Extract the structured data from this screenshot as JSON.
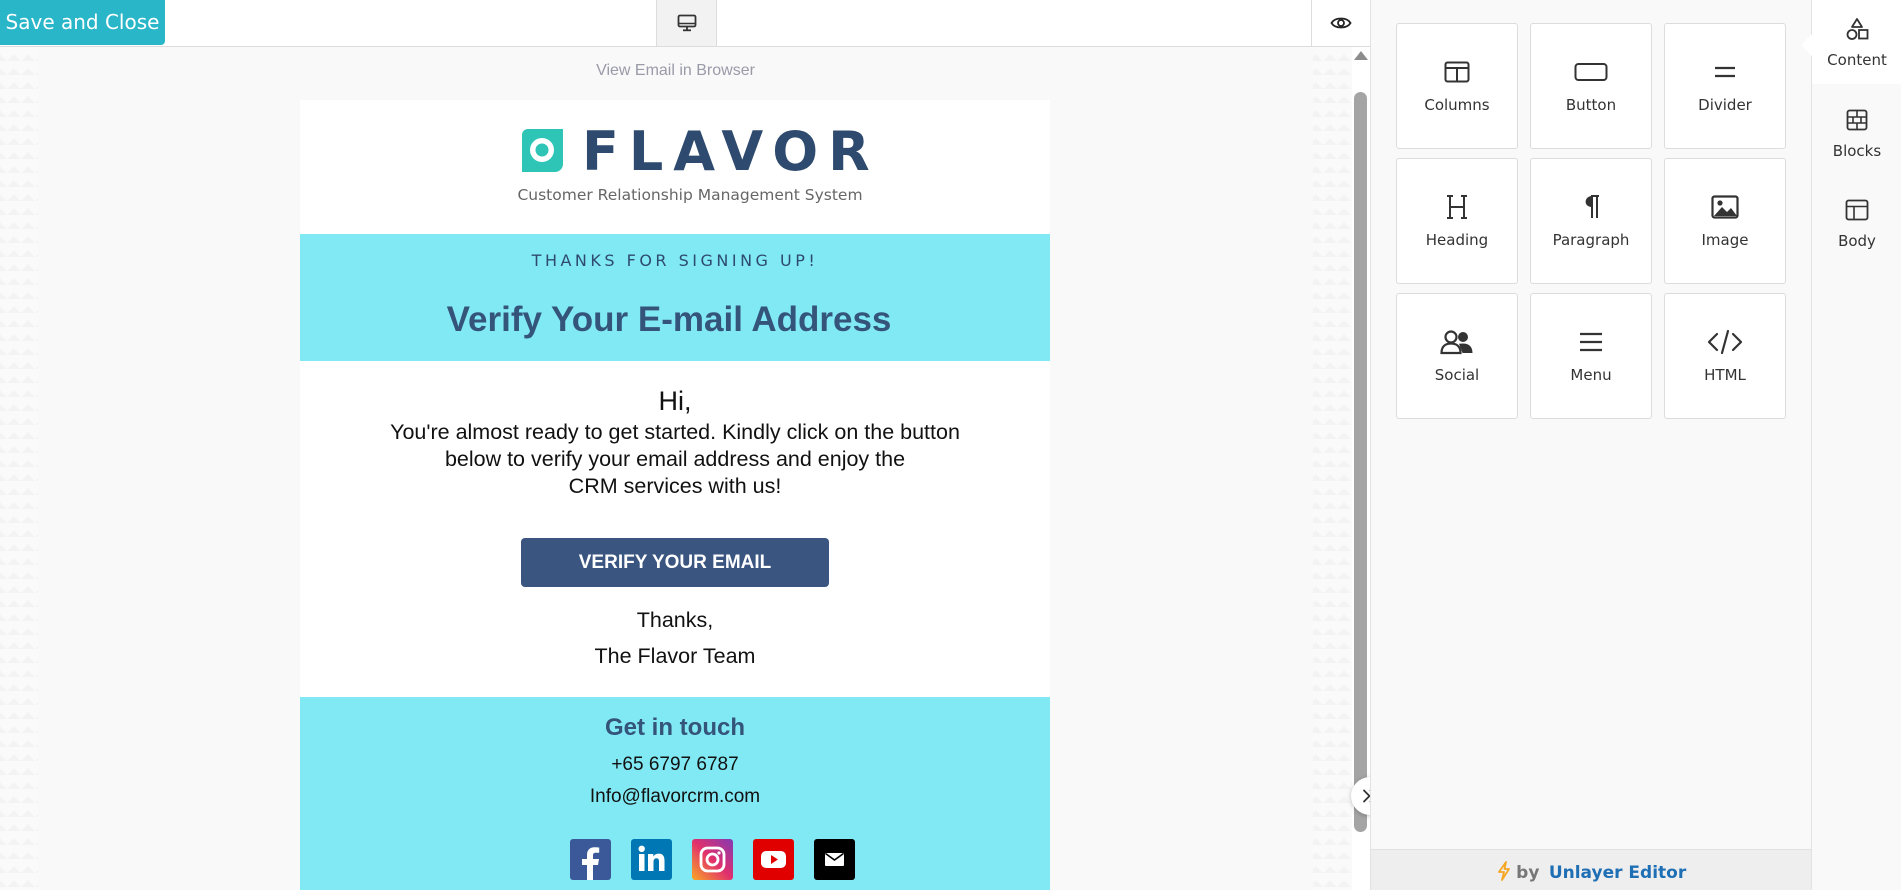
{
  "toolbar": {
    "save_close_label": "Save and Close",
    "device_icon": "desktop-icon",
    "preview_icon": "eye-icon"
  },
  "email": {
    "view_in_browser": "View Email in Browser",
    "logo_word": "FLAVOR",
    "logo_subtitle": "Customer Relationship Management System",
    "hero_kicker": "THANKS FOR SIGNING UP!",
    "hero_title": "Verify Your E-mail Address",
    "greeting": "Hi,",
    "intro_line1": "You're almost ready to get started. Kindly click on the button",
    "intro_line2": "below to verify your email address and enjoy the",
    "intro_line3": "CRM services with us!",
    "verify_button": "VERIFY YOUR EMAIL",
    "thanks": "Thanks,",
    "team": "The Flavor Team",
    "footer_title": "Get in touch",
    "phone": "+65 6797 6787",
    "mail": "Info@flavorcrm.com",
    "socials": [
      "facebook-icon",
      "linkedin-icon",
      "instagram-icon",
      "youtube-icon",
      "mail-icon"
    ]
  },
  "content_tools": [
    {
      "label": "Columns",
      "icon": "columns-icon"
    },
    {
      "label": "Button",
      "icon": "button-icon"
    },
    {
      "label": "Divider",
      "icon": "divider-icon"
    },
    {
      "label": "Heading",
      "icon": "heading-icon"
    },
    {
      "label": "Paragraph",
      "icon": "paragraph-icon"
    },
    {
      "label": "Image",
      "icon": "image-icon"
    },
    {
      "label": "Social",
      "icon": "social-icon"
    },
    {
      "label": "Menu",
      "icon": "menu-icon"
    },
    {
      "label": "HTML",
      "icon": "code-icon"
    }
  ],
  "tabs": [
    {
      "label": "Content",
      "icon": "shapes-icon",
      "active": true
    },
    {
      "label": "Blocks",
      "icon": "blocks-icon",
      "active": false
    },
    {
      "label": "Body",
      "icon": "body-layout-icon",
      "active": false
    }
  ],
  "panel_footer": {
    "by": "by",
    "brand": "Unlayer Editor"
  },
  "colors": {
    "accent": "#29b6c9",
    "hero_bg": "#80e9f3",
    "navy": "#34547a",
    "button": "#3a5580",
    "link": "#1f6fb5",
    "bolt": "#f5a623"
  }
}
